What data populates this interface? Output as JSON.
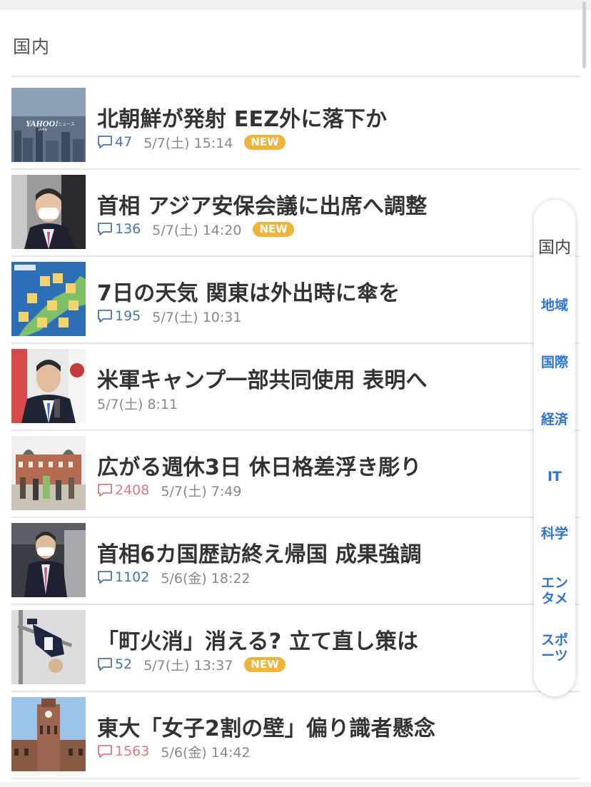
{
  "section": {
    "title": "国内"
  },
  "articles": [
    {
      "title": "北朝鮮が発射 EEZ外に落下か",
      "comments": "47",
      "comment_color": "blue",
      "date": "5/7(土) 15:14",
      "new": true,
      "thumb": "yahoo-news-logo-image"
    },
    {
      "title": "首相 アジア安保会議に出席へ調整",
      "comments": "136",
      "comment_color": "blue",
      "date": "5/7(土) 14:20",
      "new": true,
      "thumb": "prime-minister-masked-photo"
    },
    {
      "title": "7日の天気 関東は外出時に傘を",
      "comments": "195",
      "comment_color": "blue",
      "date": "5/7(土) 10:31",
      "new": false,
      "thumb": "weather-map-image"
    },
    {
      "title": "米軍キャンプ一部共同使用 表明へ",
      "comments": "",
      "comment_color": "none",
      "date": "5/7(土) 8:11",
      "new": false,
      "thumb": "prime-minister-speech-photo"
    },
    {
      "title": "広がる週休3日 休日格差浮き彫り",
      "comments": "2408",
      "comment_color": "red",
      "date": "5/7(土) 7:49",
      "new": false,
      "thumb": "tokyo-station-crowd-photo"
    },
    {
      "title": "首相6カ国歴訪終え帰国 成果強調",
      "comments": "1102",
      "comment_color": "blue",
      "date": "5/6(金) 18:22",
      "new": false,
      "thumb": "prime-minister-walking-photo"
    },
    {
      "title": "「町火消」消える? 立て直し策は",
      "comments": "52",
      "comment_color": "blue",
      "date": "5/7(土) 13:37",
      "new": true,
      "thumb": "firefighter-ladder-photo"
    },
    {
      "title": "東大「女子2割の壁」偏り識者懸念",
      "comments": "1563",
      "comment_color": "red",
      "date": "5/6(金) 14:42",
      "new": false,
      "thumb": "university-tower-photo"
    }
  ],
  "badges": {
    "new_label": "NEW"
  },
  "side_nav": {
    "items": [
      {
        "label": "国内",
        "active": true
      },
      {
        "label": "地域",
        "active": false
      },
      {
        "label": "国際",
        "active": false
      },
      {
        "label": "経済",
        "active": false
      },
      {
        "label": "IT",
        "active": false
      },
      {
        "label": "科学",
        "active": false
      },
      {
        "label": "エンタメ",
        "active": false
      },
      {
        "label": "スポーツ",
        "active": false
      }
    ]
  },
  "thumb_text": {
    "logo": "YAHOO!",
    "logo_sub": "ニュース",
    "logo_sub2": "JAPAN"
  },
  "colors": {
    "link_blue": "#2f73d6",
    "comment_blue": "#4a73b0",
    "comment_red": "#e0777d",
    "new_badge": "#f0b33a"
  }
}
